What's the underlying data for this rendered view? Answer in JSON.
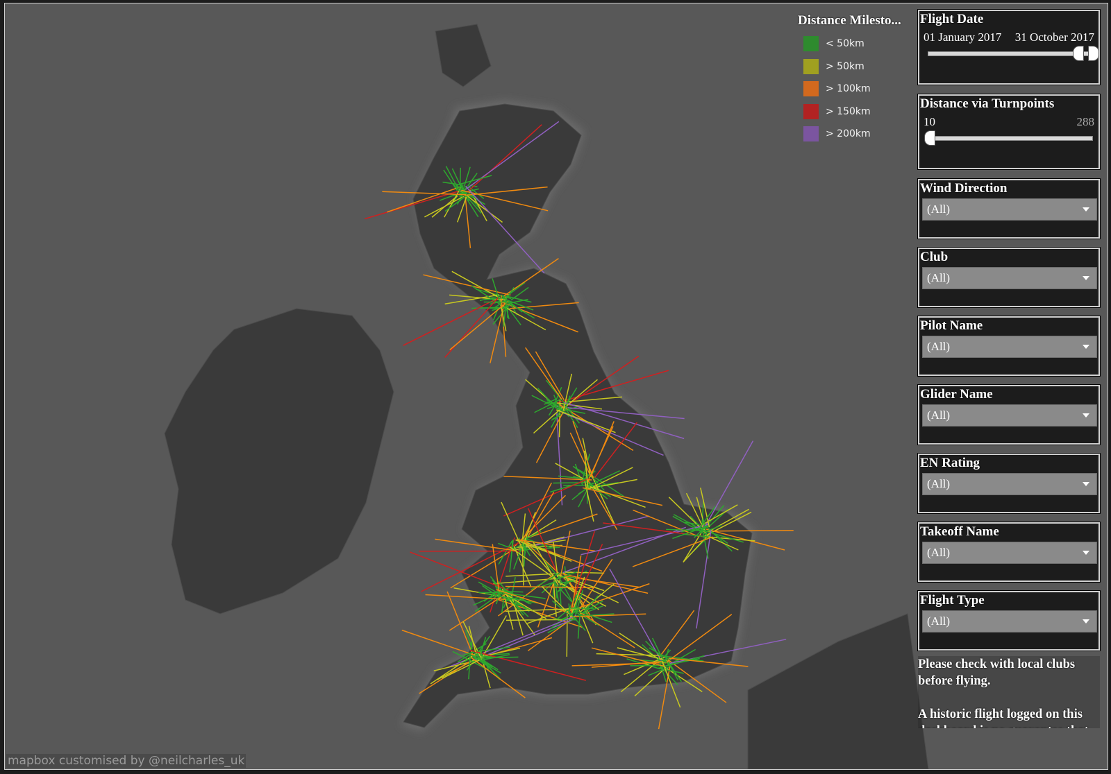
{
  "legend": {
    "title": "Distance Milesto...",
    "items": [
      {
        "label": "< 50km",
        "color": "#2e8b2e"
      },
      {
        "label": "> 50km",
        "color": "#a0a020"
      },
      {
        "label": "> 100km",
        "color": "#d2691e"
      },
      {
        "label": "> 150km",
        "color": "#b22222"
      },
      {
        "label": "> 200km",
        "color": "#7b55a0"
      }
    ]
  },
  "attribution": "mapbox customised by @neilcharles_uk",
  "filters": {
    "flight_date": {
      "title": "Flight Date",
      "start": "01 January 2017",
      "end": "31 October 2017",
      "range_selected": [
        0.94,
        1.0
      ]
    },
    "distance": {
      "title": "Distance via Turnpoints",
      "min": "10",
      "max": "288",
      "range_selected": [
        0.0,
        1.0
      ]
    },
    "wind_direction": {
      "title": "Wind Direction",
      "value": "(All)"
    },
    "club": {
      "title": "Club",
      "value": "(All)"
    },
    "pilot_name": {
      "title": "Pilot Name",
      "value": "(All)"
    },
    "glider_name": {
      "title": "Glider Name",
      "value": "(All)"
    },
    "en_rating": {
      "title": "EN Rating",
      "value": "(All)"
    },
    "takeoff_name": {
      "title": "Takeoff Name",
      "value": "(All)"
    },
    "flight_type": {
      "title": "Flight Type",
      "value": "(All)"
    }
  },
  "note": {
    "line1": "Please check with local clubs before flying.",
    "line2": "A historic flight logged on this dashboard is no guarantee that"
  }
}
